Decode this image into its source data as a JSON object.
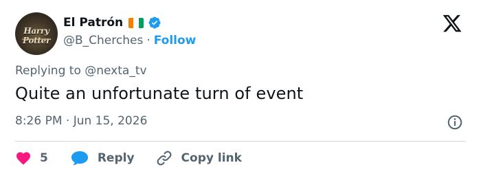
{
  "author": {
    "display_name": "El Patrón",
    "avatar_text": "Harry Potter",
    "handle": "@B_Cherches",
    "follow_label": "Follow",
    "separator": "·",
    "flag_colors": [
      "#f77f00",
      "#ffffff",
      "#009e60"
    ],
    "verified_color": "#1d9bf0"
  },
  "tweet": {
    "replying_prefix": "Replying to",
    "replying_to": "@nexta_tv",
    "text": "Quite an unfortunate turn of event",
    "timestamp": "8:26 PM · Jun 15, 2026"
  },
  "actions": {
    "like_count": "5",
    "reply_label": "Reply",
    "copy_label": "Copy link",
    "like_color": "#f91880",
    "reply_color": "#1d9bf0"
  },
  "icons": [
    "x-logo-icon",
    "verified-icon",
    "info-icon",
    "heart-icon",
    "reply-bubble-icon",
    "link-icon"
  ]
}
